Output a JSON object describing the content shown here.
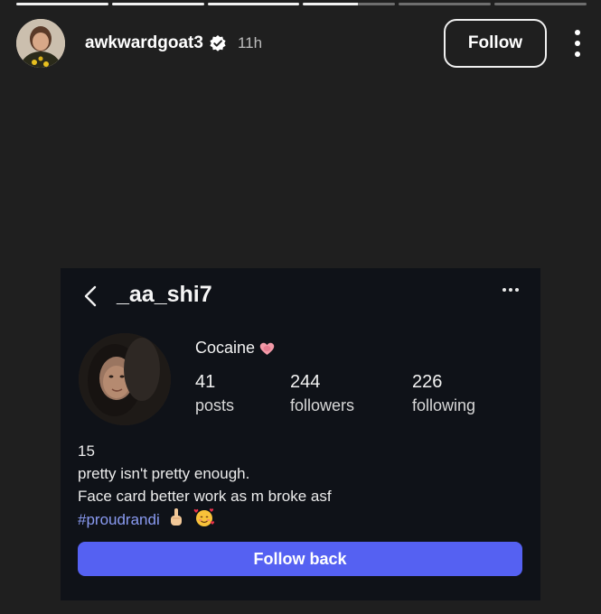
{
  "story": {
    "progress": {
      "total_segments": 6,
      "completed_segments": 3.6
    },
    "header": {
      "username": "awkwardgoat3",
      "verified": true,
      "time": "11h",
      "follow_label": "Follow"
    }
  },
  "profile_card": {
    "username": "_aa_shi7",
    "display_name": "Cocaine",
    "stats": [
      {
        "value": "41",
        "label": "posts"
      },
      {
        "value": "244",
        "label": "followers"
      },
      {
        "value": "226",
        "label": "following"
      }
    ],
    "bio": {
      "line1": "15",
      "line2": "pretty isn't pretty enough.",
      "line3": "Face card better work as m broke asf",
      "hashtag": "#proudrandi"
    },
    "follow_back_label": "Follow back"
  },
  "colors": {
    "background": "#1f1f1f",
    "card_background": "#0f1218",
    "accent_button": "#5561f2",
    "hashtag": "#8a9bf2"
  },
  "icons": [
    "verified-badge-icon",
    "more-vertical-icon",
    "back-chevron-icon",
    "more-horizontal-icon",
    "heart-emoji-icon",
    "middle-finger-emoji-icon",
    "smiling-hearts-emoji-icon"
  ]
}
